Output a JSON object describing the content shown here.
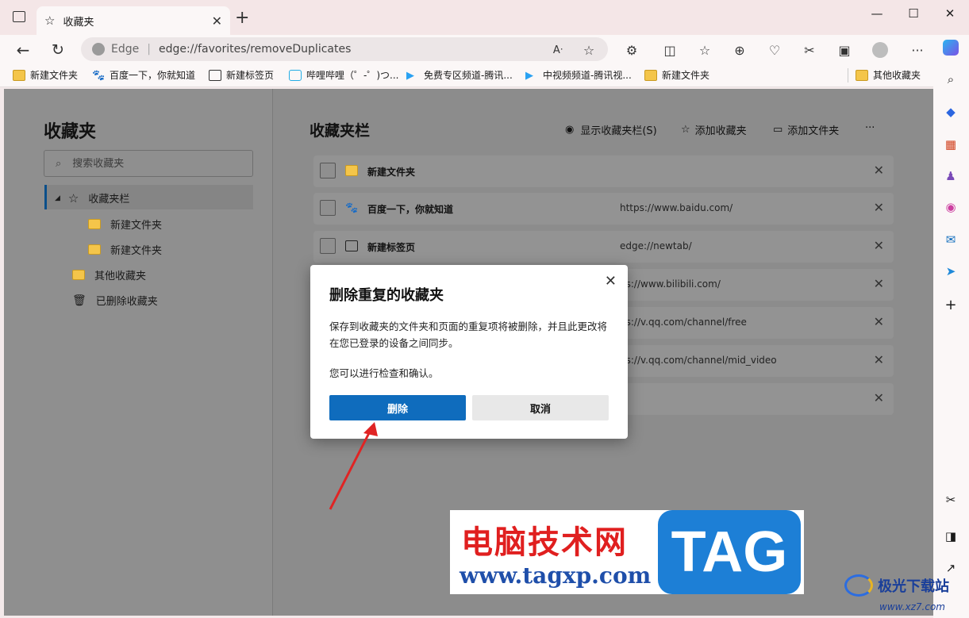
{
  "browser": {
    "tab_title": "收藏夹",
    "address_brand": "Edge",
    "address_url": "edge://favorites/removeDuplicates"
  },
  "bookmarks_bar": [
    {
      "label": "新建文件夹",
      "icon": "folder-icon"
    },
    {
      "label": "百度一下，你就知道",
      "icon": "baidu-icon"
    },
    {
      "label": "新建标签页",
      "icon": "newtab-icon"
    },
    {
      "label": "哔哩哔哩（゜-゜)つ...",
      "icon": "bilibili-icon"
    },
    {
      "label": "免费专区频道-腾讯...",
      "icon": "tencent-video-icon"
    },
    {
      "label": "中视频频道-腾讯视...",
      "icon": "tencent-video-icon"
    },
    {
      "label": "新建文件夹",
      "icon": "folder-icon"
    }
  ],
  "other_favorites": "其他收藏夹",
  "left": {
    "title": "收藏夹",
    "search_placeholder": "搜索收藏夹",
    "tree": {
      "root": "收藏夹栏",
      "child1": "新建文件夹",
      "child2": "新建文件夹",
      "other": "其他收藏夹",
      "deleted": "已删除收藏夹"
    }
  },
  "right": {
    "title": "收藏夹栏",
    "show_bar": "显示收藏夹栏(S)",
    "add_favorite": "添加收藏夹",
    "add_folder": "添加文件夹",
    "more": "···",
    "rows": [
      {
        "name": "新建文件夹",
        "url": ""
      },
      {
        "name": "百度一下，你就知道",
        "url": "https://www.baidu.com/"
      },
      {
        "name": "新建标签页",
        "url": "edge://newtab/"
      },
      {
        "name": "",
        "url": "https://www.bilibili.com/"
      },
      {
        "name": "",
        "url": "https://v.qq.com/channel/free"
      },
      {
        "name": "",
        "url": "https://v.qq.com/channel/mid_video"
      },
      {
        "name": "",
        "url": ""
      }
    ],
    "row_urls_visible": [
      "ps://www.bilibili.com/",
      "ps://v.qq.com/channel/free",
      "ps://v.qq.com/channel/mid_video"
    ]
  },
  "dialog": {
    "title": "删除重复的收藏夹",
    "body": "保存到收藏夹的文件夹和页面的重复项将被删除，并且此更改将在您已登录的设备之间同步。",
    "body2": "您可以进行检查和确认。",
    "delete_label": "删除",
    "cancel_label": "取消"
  },
  "watermark": {
    "cn": "电脑技术网",
    "url": "www.tagxp.com",
    "tag": "TAG"
  },
  "corner_logo": {
    "text": "极光下载站",
    "url": "www.xz7.com"
  },
  "colors": {
    "accent": "#0f6cbd",
    "overlay": "#8c8c8c",
    "watermark_red": "#e01f1f",
    "watermark_blue": "#1d7fd6"
  }
}
